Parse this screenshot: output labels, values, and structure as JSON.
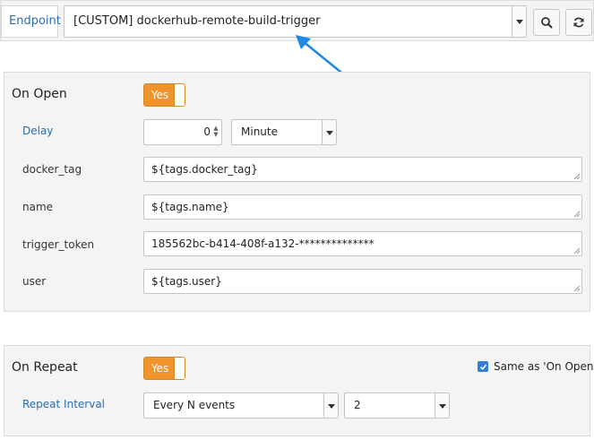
{
  "endpoint": {
    "label": "Endpoint",
    "selected": "[CUSTOM] dockerhub-remote-build-trigger",
    "search_icon": "search-icon",
    "refresh_icon": "refresh-icon"
  },
  "on_open": {
    "title": "On Open",
    "toggle_label": "Yes",
    "delay": {
      "label": "Delay",
      "value": "0",
      "unit": "Minute"
    },
    "fields": [
      {
        "label": "docker_tag",
        "value": "${tags.docker_tag}"
      },
      {
        "label": "name",
        "value": "${tags.name}"
      },
      {
        "label": "trigger_token",
        "value": "185562bc-b414-408f-a132-**************"
      },
      {
        "label": "user",
        "value": "${tags.user}"
      }
    ]
  },
  "on_repeat": {
    "title": "On Repeat",
    "toggle_label": "Yes",
    "same_as_label": "Same as 'On Open'",
    "same_as_checked": true,
    "repeat_interval": {
      "label": "Repeat Interval",
      "mode": "Every N events",
      "count": "2"
    }
  },
  "colors": {
    "accent": "#f0932b",
    "link": "#2a6db0",
    "annotation_arrow": "#1e88e5",
    "checkbox": "#2f7ed8"
  }
}
